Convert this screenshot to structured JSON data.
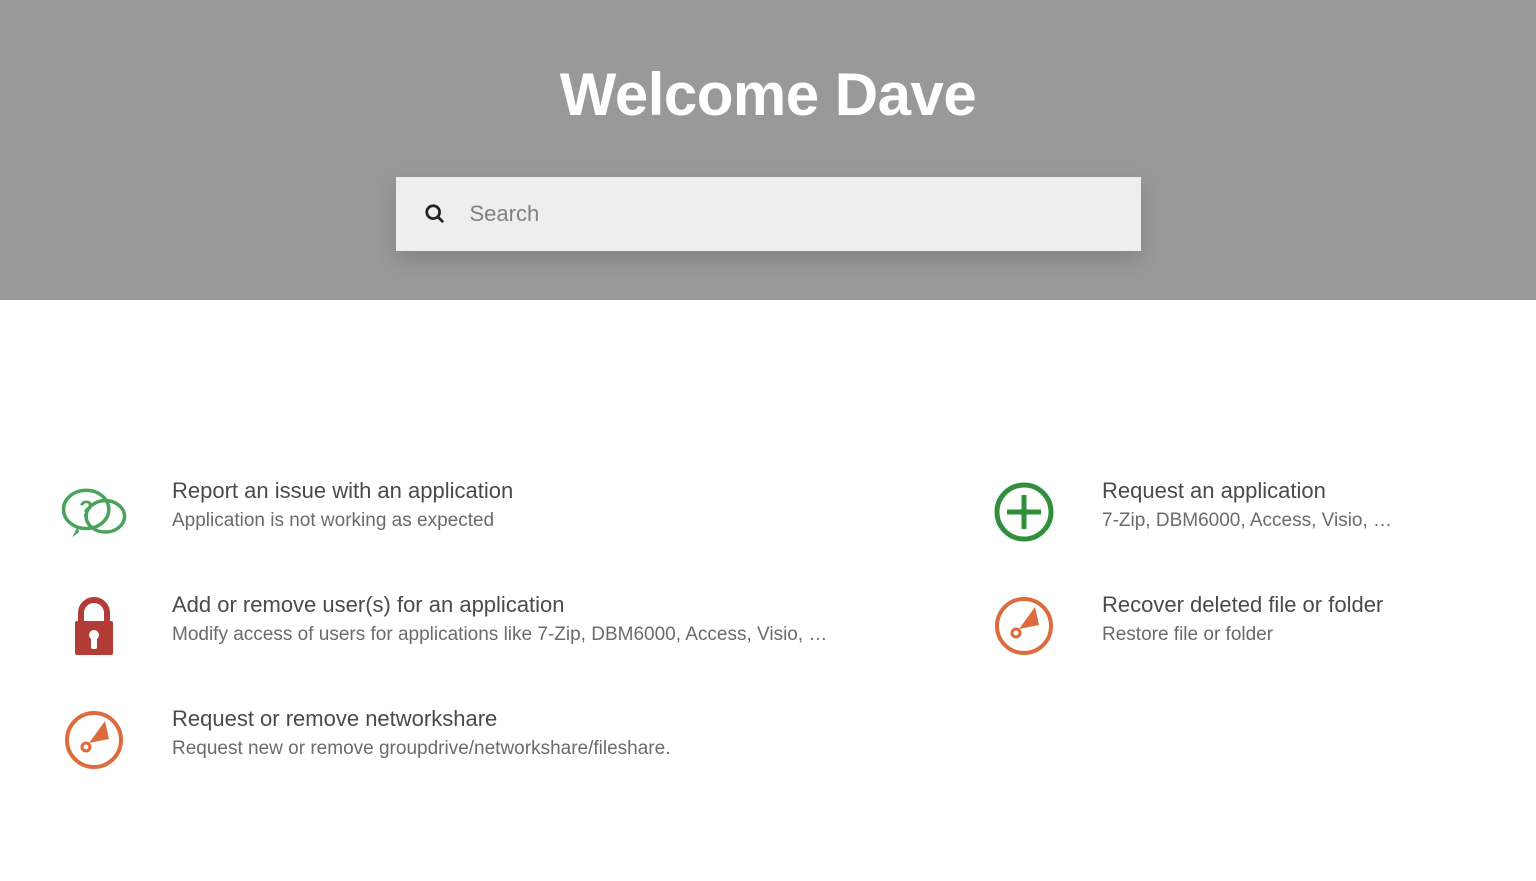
{
  "hero": {
    "title": "Welcome Dave",
    "search_placeholder": "Search"
  },
  "catalog": {
    "left": [
      {
        "icon": "question-chat-icon",
        "title": "Report an issue with an application",
        "desc": "Application is not working as expected"
      },
      {
        "icon": "lock-icon",
        "title": "Add or remove user(s) for an application",
        "desc": "Modify access of users for applications like 7-Zip, DBM6000, Access, Visio, …"
      },
      {
        "icon": "gauge-icon",
        "title": "Request or remove networkshare",
        "desc": "Request new or remove groupdrive/networkshare/fileshare."
      }
    ],
    "right": [
      {
        "icon": "plus-circle-icon",
        "title": "Request an application",
        "desc": "7-Zip, DBM6000, Access, Visio, …"
      },
      {
        "icon": "gauge-icon",
        "title": "Recover deleted file or folder",
        "desc": "Restore file or folder"
      }
    ]
  },
  "colors": {
    "green": "#2f8f3b",
    "orange": "#dc6b3e",
    "red": "#b33d36"
  }
}
